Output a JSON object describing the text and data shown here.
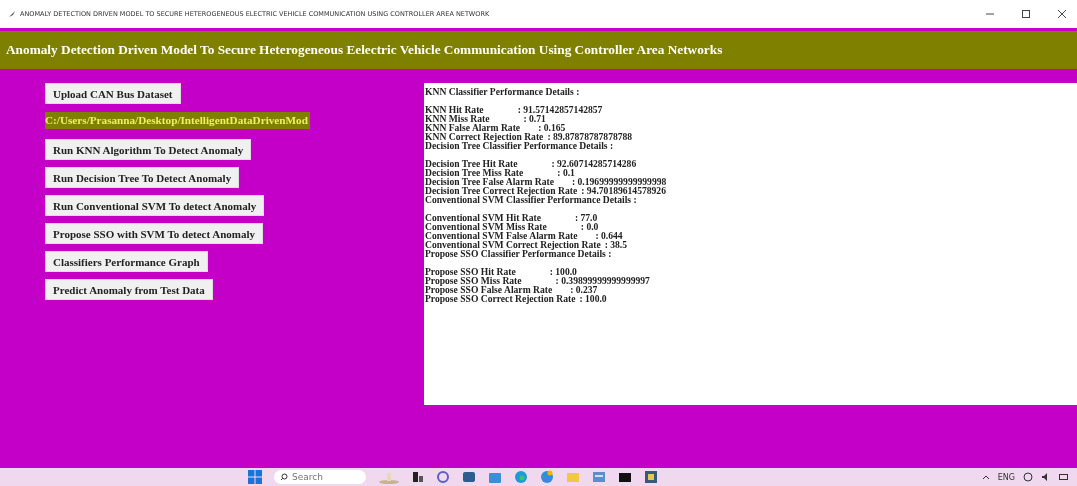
{
  "window": {
    "title": "ANOMALY DETECTION DRIVEN MODEL TO SECURE HETEROGENEOUS ELECTRIC VEHICLE COMMUNICATION USING CONTROLLER AREA NETWORK"
  },
  "header": "Anomaly Detection Driven Model To Secure Heterogeneous Eelectric Vehicle Communication Using Controller Area Networks",
  "controls": [
    {
      "kind": "button",
      "label": "Upload CAN Bus Dataset"
    },
    {
      "kind": "path",
      "label": "C:/Users/Prasanna/Desktop/IntelligentDataDrivenMod"
    },
    {
      "kind": "button",
      "label": "Run KNN Algorithm To Detect Anomaly"
    },
    {
      "kind": "button",
      "label": "Run Decision Tree To Detect Anomaly"
    },
    {
      "kind": "button",
      "label": "Run Conventional SVM To detect Anomaly"
    },
    {
      "kind": "button",
      "label": "Propose SSO with SVM To detect Anomaly"
    },
    {
      "kind": "button",
      "label": "Classifiers Performance Graph"
    },
    {
      "kind": "button",
      "label": "Predict Anomaly from Test Data"
    }
  ],
  "output": [
    {
      "heading": "KNN Classifier Performance Details :",
      "rows": [
        {
          "label": "KNN Hit Rate",
          "value": ": 91.57142857142857"
        },
        {
          "label": "KNN Miss Rate",
          "value": ": 0.71"
        },
        {
          "label": "KNN False Alarm Rate",
          "value": ": 0.165"
        },
        {
          "label": "KNN Correct Rejection Rate",
          "value": ": 89.87878787878788"
        }
      ]
    },
    {
      "heading": "Decision Tree Classifier Performance Details :",
      "rows": [
        {
          "label": "Decision Tree Hit Rate",
          "value": ": 92.60714285714286"
        },
        {
          "label": "Decision Tree Miss Rate",
          "value": ": 0.1"
        },
        {
          "label": "Decision Tree False Alarm Rate",
          "value": ": 0.19699999999999998"
        },
        {
          "label": "Decision Tree Correct Rejection Rate",
          "value": ": 94.70189614578926"
        }
      ]
    },
    {
      "heading": "Conventional SVM Classifier Performance Details :",
      "rows": [
        {
          "label": "Conventional SVM Hit Rate",
          "value": ": 77.0"
        },
        {
          "label": "Conventional SVM Miss Rate",
          "value": ": 0.0"
        },
        {
          "label": "Conventional SVM False Alarm Rate",
          "value": ": 0.644"
        },
        {
          "label": "Conventional SVM Correct Rejection Rate",
          "value": ": 38.5"
        }
      ]
    },
    {
      "heading": "Propose SSO Classifier Performance Details :",
      "rows": [
        {
          "label": "Propose SSO Hit Rate",
          "value": ": 100.0"
        },
        {
          "label": "Propose SSO Miss Rate",
          "value": ": 0.39899999999999997"
        },
        {
          "label": "Propose SSO False Alarm Rate",
          "value": ": 0.237"
        },
        {
          "label": "Propose SSO Correct Rejection Rate",
          "value": ": 100.0"
        }
      ]
    }
  ],
  "taskbar": {
    "search": {
      "placeholder": "Search"
    },
    "language": "ENG"
  }
}
